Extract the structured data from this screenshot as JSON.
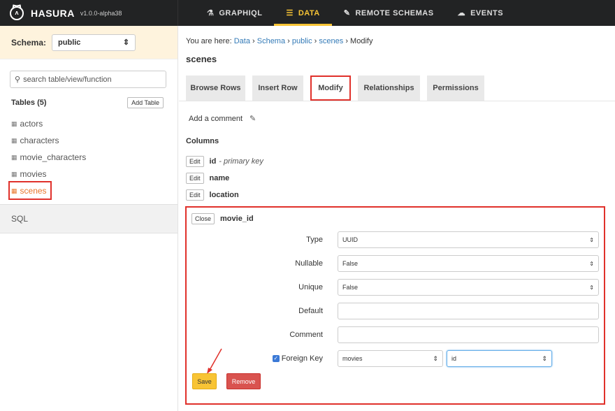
{
  "brand": {
    "name": "HASURA",
    "version": "v1.0.0-alpha38"
  },
  "nav": [
    {
      "label": "GRAPHIQL",
      "icon": "flask-icon",
      "glyph": "⚗",
      "active": false
    },
    {
      "label": "DATA",
      "icon": "database-icon",
      "glyph": "☰",
      "active": true
    },
    {
      "label": "REMOTE SCHEMAS",
      "icon": "plug-icon",
      "glyph": "✎",
      "active": false
    },
    {
      "label": "EVENTS",
      "icon": "cloud-icon",
      "glyph": "☁",
      "active": false
    }
  ],
  "sidebar": {
    "schema_label": "Schema:",
    "schema_value": "public",
    "search_placeholder": "search table/view/function",
    "tables_title": "Tables (5)",
    "add_table_label": "Add Table",
    "tables": [
      "actors",
      "characters",
      "movie_characters",
      "movies",
      "scenes"
    ],
    "active_table": "scenes",
    "sql_label": "SQL"
  },
  "main": {
    "breadcrumb": {
      "prefix": "You are here: ",
      "items": [
        "Data",
        "Schema",
        "public",
        "scenes",
        "Modify"
      ],
      "separator": " › "
    },
    "title": "scenes",
    "tabs": [
      "Browse Rows",
      "Insert Row",
      "Modify",
      "Relationships",
      "Permissions"
    ],
    "active_tab": "Modify",
    "add_comment_label": "Add a comment",
    "columns_title": "Columns",
    "edit_label": "Edit",
    "columns": [
      {
        "name": "id",
        "meta": "- primary key"
      },
      {
        "name": "name",
        "meta": ""
      },
      {
        "name": "location",
        "meta": ""
      }
    ],
    "editing": {
      "close_label": "Close",
      "column_name": "movie_id",
      "type_label": "Type",
      "type_value": "UUID",
      "nullable_label": "Nullable",
      "nullable_value": "False",
      "unique_label": "Unique",
      "unique_value": "False",
      "default_label": "Default",
      "default_value": "",
      "comment_label": "Comment",
      "comment_value": "",
      "fk_label": "Foreign Key",
      "fk_checked": true,
      "fk_table": "movies",
      "fk_column": "id",
      "save_label": "Save",
      "remove_label": "Remove"
    }
  },
  "colors": {
    "topbar": "#222324",
    "accent": "#f8c435",
    "highlight": "#e0312b",
    "active_table": "#e8762b"
  }
}
